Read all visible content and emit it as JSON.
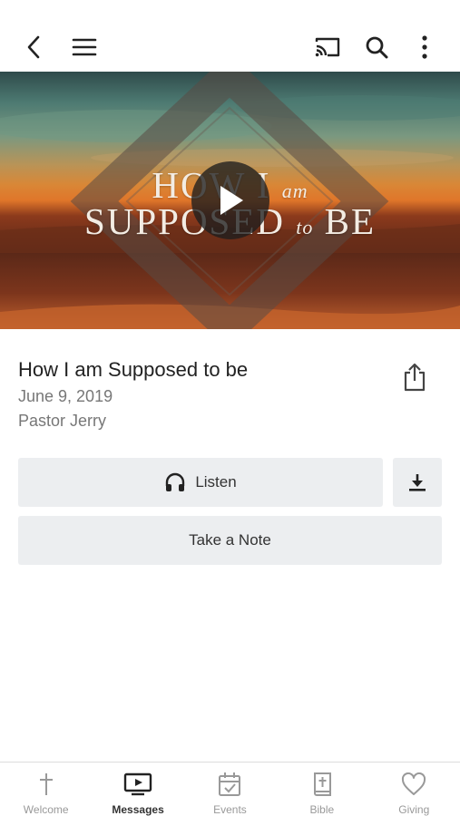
{
  "topbar": {
    "back_icon": "chevron-left-icon",
    "menu_icon": "hamburger-menu-icon",
    "cast_icon": "cast-icon",
    "search_icon": "search-icon",
    "more_icon": "vertical-dots-icon"
  },
  "hero": {
    "title_line1_a": "HOW I",
    "title_line1_b": "am",
    "title_line2_a": "SUPPOSED",
    "title_line2_b": "to",
    "title_line2_c": "BE",
    "play_icon": "play-icon"
  },
  "message": {
    "title": "How I am Supposed to be",
    "date": "June 9, 2019",
    "speaker": "Pastor Jerry",
    "share_icon": "share-icon"
  },
  "actions": {
    "listen_label": "Listen",
    "listen_icon": "headphones-icon",
    "download_icon": "download-icon",
    "note_label": "Take a Note"
  },
  "tabs": [
    {
      "label": "Welcome",
      "icon": "cross-icon",
      "active": false
    },
    {
      "label": "Messages",
      "icon": "video-play-icon",
      "active": true
    },
    {
      "label": "Events",
      "icon": "calendar-check-icon",
      "active": false
    },
    {
      "label": "Bible",
      "icon": "bible-icon",
      "active": false
    },
    {
      "label": "Giving",
      "icon": "heart-icon",
      "active": false
    }
  ],
  "colors": {
    "tab_active": "#333333",
    "tab_inactive": "#999999",
    "button_bg": "#eceef0"
  }
}
